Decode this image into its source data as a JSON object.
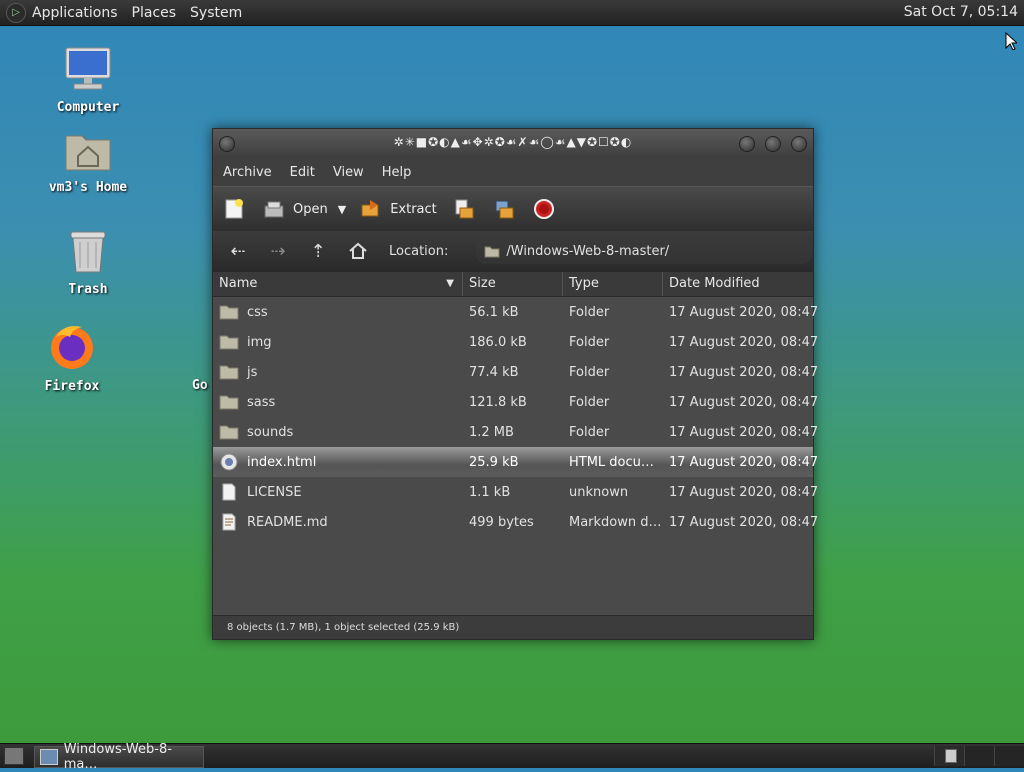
{
  "topbar": {
    "menus": [
      "Applications",
      "Places",
      "System"
    ],
    "clock": "Sat Oct  7, 05:14"
  },
  "desktop": {
    "icons": [
      {
        "label": "Computer",
        "icon": "computer-icon"
      },
      {
        "label": "vm3's Home",
        "icon": "home-folder-icon"
      },
      {
        "label": "Trash",
        "icon": "trash-icon"
      },
      {
        "label": "Firefox",
        "icon": "firefox-icon"
      }
    ],
    "partial_label": "Go"
  },
  "window": {
    "title": "✲✳■✪◐▲☙✥✲✪☙✗☙◯☙▲▼✪☐✪◐",
    "menubar": [
      "Archive",
      "Edit",
      "View",
      "Help"
    ],
    "toolbar": {
      "open_label": "Open",
      "extract_label": "Extract"
    },
    "location": {
      "label": "Location:",
      "path": "/Windows-Web-8-master/"
    },
    "columns": {
      "name": "Name",
      "size": "Size",
      "type": "Type",
      "modified": "Date Modified"
    },
    "files": [
      {
        "name": "css",
        "size": "56.1 kB",
        "type": "Folder",
        "modified": "17 August 2020, 08:47",
        "icon": "folder-icon"
      },
      {
        "name": "img",
        "size": "186.0 kB",
        "type": "Folder",
        "modified": "17 August 2020, 08:47",
        "icon": "folder-icon"
      },
      {
        "name": "js",
        "size": "77.4 kB",
        "type": "Folder",
        "modified": "17 August 2020, 08:47",
        "icon": "folder-icon"
      },
      {
        "name": "sass",
        "size": "121.8 kB",
        "type": "Folder",
        "modified": "17 August 2020, 08:47",
        "icon": "folder-icon"
      },
      {
        "name": "sounds",
        "size": "1.2 MB",
        "type": "Folder",
        "modified": "17 August 2020, 08:47",
        "icon": "folder-icon"
      },
      {
        "name": "index.html",
        "size": "25.9 kB",
        "type": "HTML docu…",
        "modified": "17 August 2020, 08:47",
        "icon": "html-file-icon",
        "selected": true
      },
      {
        "name": "LICENSE",
        "size": "1.1 kB",
        "type": "unknown",
        "modified": "17 August 2020, 08:47",
        "icon": "file-icon"
      },
      {
        "name": "README.md",
        "size": "499 bytes",
        "type": "Markdown d…",
        "modified": "17 August 2020, 08:47",
        "icon": "text-file-icon"
      }
    ],
    "status": "8 objects (1.7 MB), 1 object selected (25.9 kB)"
  },
  "taskbar": {
    "task_label": "Windows-Web-8-ma…"
  }
}
